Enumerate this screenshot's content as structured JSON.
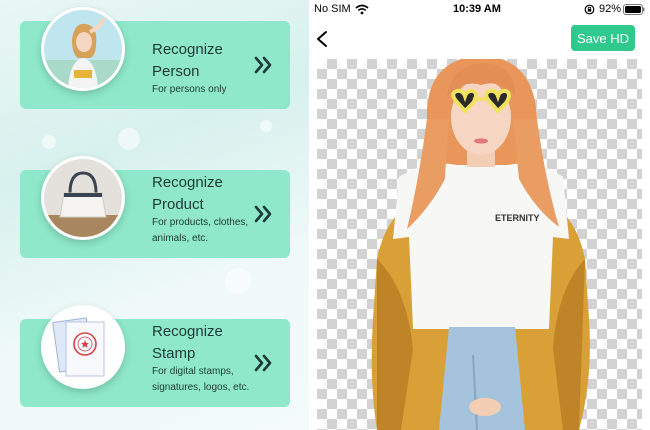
{
  "features": [
    {
      "title_line1": "Recognize",
      "title_line2": "Person",
      "description": "For persons only",
      "icon": "person-photo-icon"
    },
    {
      "title_line1": "Recognize",
      "title_line2": "Product",
      "description": "For products, clothes, animals, etc.",
      "icon": "handbag-photo-icon"
    },
    {
      "title_line1": "Recognize",
      "title_line2": "Stamp",
      "description": "For digital stamps, signatures, logos, etc.",
      "icon": "stamp-photo-icon"
    }
  ],
  "status_bar": {
    "carrier": "No SIM",
    "time": "10:39 AM",
    "battery": "92%"
  },
  "toolbar": {
    "save_label": "Save HD"
  },
  "editor": {
    "shirt_text": "ETERNITY"
  },
  "colors": {
    "card": "#8ee8c9",
    "accent": "#2fc98d",
    "checker": "#d2d2d2"
  }
}
